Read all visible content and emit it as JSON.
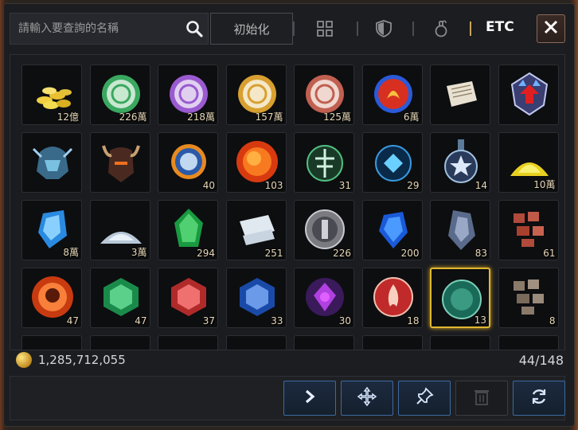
{
  "search": {
    "placeholder": "請輸入要查詢的名稱"
  },
  "toolbar": {
    "reset_label": "初始化",
    "etc_label": "ETC"
  },
  "gold": {
    "amount": "1,285,712,055"
  },
  "inventory": {
    "capacity": "44/148",
    "rows": [
      [
        {
          "icon": "gold-coins-icon",
          "qty": "12億"
        },
        {
          "icon": "green-coin-icon",
          "qty": "226萬"
        },
        {
          "icon": "purple-coin-icon",
          "qty": "218萬"
        },
        {
          "icon": "gold-coin-icon",
          "qty": "157萬"
        },
        {
          "icon": "copper-coin-icon",
          "qty": "125萬"
        },
        {
          "icon": "phoenix-coin-icon",
          "qty": "6萬"
        },
        {
          "icon": "scroll-icon",
          "qty": ""
        },
        {
          "icon": "upgrade-shield-icon",
          "qty": ""
        }
      ],
      [
        {
          "icon": "blue-helmet-icon",
          "qty": ""
        },
        {
          "icon": "demon-helmet-icon",
          "qty": ""
        },
        {
          "icon": "blue-ring-coin-icon",
          "qty": "40"
        },
        {
          "icon": "fire-orb-icon",
          "qty": "103"
        },
        {
          "icon": "green-emblem-icon",
          "qty": "31"
        },
        {
          "icon": "blue-emblem-icon",
          "qty": "29"
        },
        {
          "icon": "star-medal-icon",
          "qty": "14"
        },
        {
          "icon": "gold-dust-icon",
          "qty": "10萬"
        }
      ],
      [
        {
          "icon": "blue-crystal-icon",
          "qty": "8萬"
        },
        {
          "icon": "silver-dust-icon",
          "qty": "3萬"
        },
        {
          "icon": "green-gem-icon",
          "qty": "294"
        },
        {
          "icon": "paper-icon",
          "qty": "251"
        },
        {
          "icon": "silver-medal-icon",
          "qty": "226"
        },
        {
          "icon": "blue-gem-icon",
          "qty": "200"
        },
        {
          "icon": "dark-crystal-icon",
          "qty": "83"
        },
        {
          "icon": "red-ore-icon",
          "qty": "61"
        }
      ],
      [
        {
          "icon": "skull-orb-icon",
          "qty": "47"
        },
        {
          "icon": "green-jewel-icon",
          "qty": "47"
        },
        {
          "icon": "red-jewel-icon",
          "qty": "37"
        },
        {
          "icon": "blue-jewel-icon",
          "qty": "33"
        },
        {
          "icon": "purple-gem-icon",
          "qty": "30"
        },
        {
          "icon": "fire-medal-icon",
          "qty": "18"
        },
        {
          "icon": "jade-coin-icon",
          "qty": "13"
        },
        {
          "icon": "stone-ore-icon",
          "qty": "8"
        }
      ]
    ]
  },
  "colors": {
    "accent": "#c9a45a",
    "selected": "#e0b830",
    "button_border": "#3c6aa0"
  }
}
